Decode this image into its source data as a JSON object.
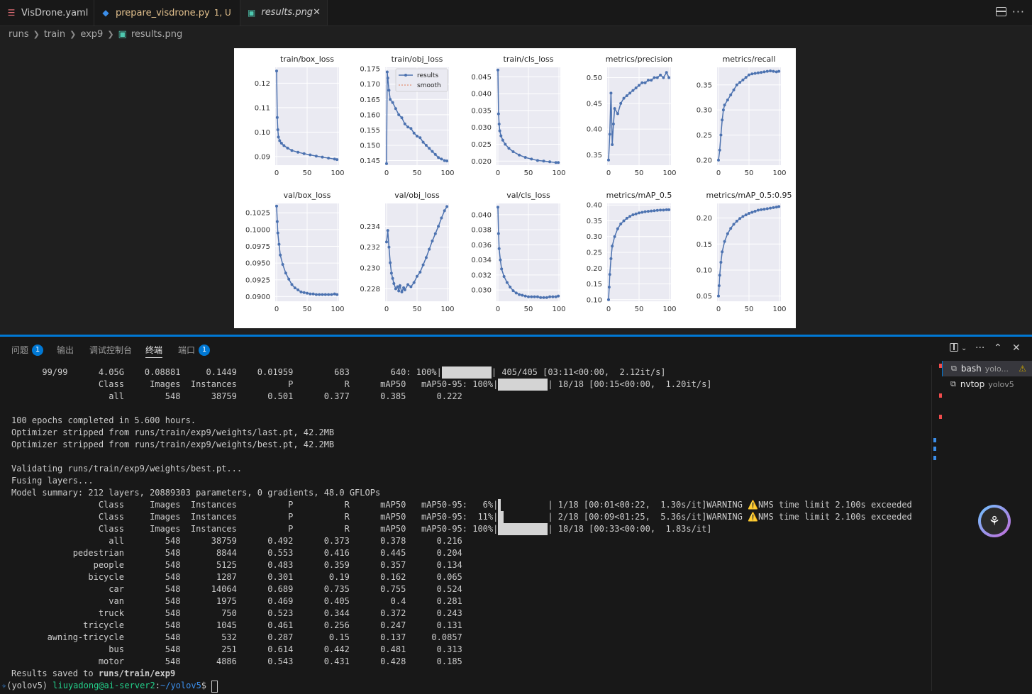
{
  "tabs": [
    {
      "label": "VisDrone.yaml",
      "icon": "yaml-icon",
      "color": "#e06c75"
    },
    {
      "label": "prepare_visdrone.py",
      "suffix": "1, U",
      "icon": "python-icon",
      "color": "#e2c08d"
    },
    {
      "label": "results.png",
      "icon": "image-icon",
      "color": "#cccccc"
    }
  ],
  "breadcrumb": [
    "runs",
    "train",
    "exp9",
    "results.png"
  ],
  "charts": {
    "legend": [
      "results",
      "smooth"
    ],
    "series_color": "#4c72b0",
    "smooth_color": "#e07b54"
  },
  "chart_data": [
    {
      "type": "line",
      "title": "train/box_loss",
      "x_ticks": [
        "0",
        "50",
        "100"
      ],
      "y_ticks": [
        "0.12",
        "0.11",
        "0.10",
        "0.09"
      ],
      "ylim": [
        0.0865,
        0.1265
      ],
      "x": [
        0,
        1,
        2,
        3,
        5,
        8,
        12,
        18,
        25,
        35,
        45,
        55,
        65,
        75,
        85,
        95,
        99
      ],
      "y": [
        0.125,
        0.106,
        0.101,
        0.098,
        0.0965,
        0.0955,
        0.0945,
        0.0935,
        0.0925,
        0.0918,
        0.0912,
        0.0907,
        0.0902,
        0.0898,
        0.0894,
        0.089,
        0.0888
      ]
    },
    {
      "type": "line",
      "title": "train/obj_loss",
      "x_ticks": [
        "0",
        "50",
        "100"
      ],
      "y_ticks": [
        "0.175",
        "0.170",
        "0.165",
        "0.160",
        "0.155",
        "0.150",
        "0.145"
      ],
      "ylim": [
        0.1435,
        0.1755
      ],
      "x": [
        0,
        1,
        2,
        4,
        6,
        10,
        15,
        20,
        25,
        30,
        35,
        40,
        45,
        50,
        55,
        60,
        65,
        70,
        75,
        80,
        85,
        90,
        95,
        99
      ],
      "y": [
        0.144,
        0.174,
        0.172,
        0.168,
        0.165,
        0.164,
        0.162,
        0.16,
        0.159,
        0.157,
        0.156,
        0.1555,
        0.154,
        0.153,
        0.1525,
        0.151,
        0.15,
        0.149,
        0.148,
        0.147,
        0.146,
        0.1455,
        0.145,
        0.1449
      ]
    },
    {
      "type": "line",
      "title": "train/cls_loss",
      "x_ticks": [
        "0",
        "50",
        "100"
      ],
      "y_ticks": [
        "0.045",
        "0.040",
        "0.035",
        "0.030",
        "0.025",
        "0.020"
      ],
      "ylim": [
        0.0188,
        0.0478
      ],
      "x": [
        0,
        1,
        2,
        3,
        5,
        8,
        12,
        18,
        25,
        35,
        45,
        55,
        65,
        75,
        85,
        95,
        99
      ],
      "y": [
        0.047,
        0.034,
        0.031,
        0.029,
        0.0275,
        0.0262,
        0.025,
        0.0238,
        0.0228,
        0.0218,
        0.0211,
        0.0206,
        0.0202,
        0.02,
        0.0198,
        0.0196,
        0.0196
      ]
    },
    {
      "type": "line",
      "title": "metrics/precision",
      "x_ticks": [
        "0",
        "50",
        "100"
      ],
      "y_ticks": [
        "0.50",
        "0.45",
        "0.40",
        "0.35"
      ],
      "ylim": [
        0.33,
        0.52
      ],
      "x": [
        0,
        2,
        4,
        6,
        8,
        10,
        15,
        20,
        25,
        30,
        35,
        40,
        45,
        50,
        55,
        60,
        65,
        70,
        75,
        80,
        85,
        90,
        95,
        99
      ],
      "y": [
        0.34,
        0.39,
        0.47,
        0.37,
        0.41,
        0.44,
        0.43,
        0.45,
        0.46,
        0.465,
        0.47,
        0.475,
        0.48,
        0.485,
        0.49,
        0.49,
        0.495,
        0.495,
        0.5,
        0.5,
        0.505,
        0.5,
        0.51,
        0.5
      ]
    },
    {
      "type": "line",
      "title": "metrics/recall",
      "x_ticks": [
        "0",
        "50",
        "100"
      ],
      "y_ticks": [
        "0.35",
        "0.30",
        "0.25",
        "0.20"
      ],
      "ylim": [
        0.19,
        0.385
      ],
      "x": [
        0,
        2,
        4,
        6,
        8,
        10,
        15,
        20,
        25,
        30,
        35,
        40,
        45,
        50,
        55,
        60,
        65,
        70,
        75,
        80,
        85,
        90,
        95,
        99
      ],
      "y": [
        0.2,
        0.22,
        0.25,
        0.28,
        0.3,
        0.31,
        0.32,
        0.33,
        0.34,
        0.35,
        0.355,
        0.36,
        0.365,
        0.37,
        0.372,
        0.373,
        0.374,
        0.375,
        0.376,
        0.377,
        0.378,
        0.377,
        0.376,
        0.377
      ]
    },
    {
      "type": "line",
      "title": "val/box_loss",
      "x_ticks": [
        "0",
        "50",
        "100"
      ],
      "y_ticks": [
        "0.1025",
        "0.1000",
        "0.0975",
        "0.0950",
        "0.0925",
        "0.0900"
      ],
      "ylim": [
        0.0893,
        0.1039
      ],
      "x": [
        0,
        1,
        2,
        4,
        6,
        10,
        15,
        20,
        25,
        30,
        35,
        40,
        45,
        50,
        55,
        60,
        65,
        70,
        75,
        80,
        85,
        90,
        95,
        99
      ],
      "y": [
        0.1035,
        0.1012,
        0.0995,
        0.0978,
        0.0962,
        0.0948,
        0.0935,
        0.0926,
        0.0918,
        0.0913,
        0.091,
        0.0907,
        0.0906,
        0.0905,
        0.0904,
        0.0904,
        0.0903,
        0.0903,
        0.0903,
        0.0903,
        0.0903,
        0.0903,
        0.0904,
        0.0903
      ]
    },
    {
      "type": "line",
      "title": "val/obj_loss",
      "x_ticks": [
        "0",
        "50",
        "100"
      ],
      "y_ticks": [
        "0.234",
        "0.232",
        "0.230",
        "0.228"
      ],
      "ylim": [
        0.2268,
        0.2362
      ],
      "x": [
        0,
        2,
        4,
        6,
        8,
        10,
        12,
        15,
        18,
        20,
        22,
        25,
        28,
        30,
        35,
        40,
        45,
        50,
        55,
        60,
        65,
        70,
        75,
        80,
        85,
        90,
        95,
        99
      ],
      "y": [
        0.2325,
        0.2336,
        0.232,
        0.2305,
        0.2295,
        0.229,
        0.2285,
        0.228,
        0.2282,
        0.2278,
        0.2283,
        0.2277,
        0.2281,
        0.2279,
        0.2284,
        0.2282,
        0.2286,
        0.2292,
        0.2296,
        0.2303,
        0.231,
        0.2318,
        0.2326,
        0.2333,
        0.234,
        0.2348,
        0.2355,
        0.2359
      ]
    },
    {
      "type": "line",
      "title": "val/cls_loss",
      "x_ticks": [
        "0",
        "50",
        "100"
      ],
      "y_ticks": [
        "0.040",
        "0.038",
        "0.036",
        "0.034",
        "0.032",
        "0.030"
      ],
      "ylim": [
        0.0285,
        0.0415
      ],
      "x": [
        0,
        1,
        2,
        4,
        6,
        10,
        15,
        20,
        25,
        30,
        35,
        40,
        45,
        50,
        55,
        60,
        65,
        70,
        75,
        80,
        85,
        90,
        95,
        99
      ],
      "y": [
        0.041,
        0.0375,
        0.0355,
        0.034,
        0.0328,
        0.0318,
        0.031,
        0.0304,
        0.0299,
        0.0296,
        0.0294,
        0.0293,
        0.0292,
        0.0291,
        0.0291,
        0.0291,
        0.0291,
        0.029,
        0.029,
        0.029,
        0.0291,
        0.0291,
        0.0291,
        0.0292
      ]
    },
    {
      "type": "line",
      "title": "metrics/mAP_0.5",
      "x_ticks": [
        "0",
        "50",
        "100"
      ],
      "y_ticks": [
        "0.40",
        "0.35",
        "0.30",
        "0.25",
        "0.20",
        "0.15",
        "0.10"
      ],
      "ylim": [
        0.095,
        0.405
      ],
      "x": [
        0,
        1,
        2,
        4,
        6,
        10,
        15,
        20,
        25,
        30,
        35,
        40,
        45,
        50,
        55,
        60,
        65,
        70,
        75,
        80,
        85,
        90,
        95,
        99
      ],
      "y": [
        0.1,
        0.14,
        0.18,
        0.23,
        0.27,
        0.3,
        0.325,
        0.34,
        0.35,
        0.358,
        0.364,
        0.369,
        0.372,
        0.375,
        0.377,
        0.379,
        0.38,
        0.381,
        0.382,
        0.383,
        0.384,
        0.384,
        0.385,
        0.385
      ]
    },
    {
      "type": "line",
      "title": "metrics/mAP_0.5:0.95",
      "x_ticks": [
        "0",
        "50",
        "100"
      ],
      "y_ticks": [
        "0.20",
        "0.15",
        "0.10",
        "0.05"
      ],
      "ylim": [
        0.04,
        0.228
      ],
      "x": [
        0,
        1,
        2,
        4,
        6,
        10,
        15,
        20,
        25,
        30,
        35,
        40,
        45,
        50,
        55,
        60,
        65,
        70,
        75,
        80,
        85,
        90,
        95,
        99
      ],
      "y": [
        0.05,
        0.07,
        0.09,
        0.115,
        0.135,
        0.155,
        0.17,
        0.18,
        0.188,
        0.194,
        0.199,
        0.203,
        0.206,
        0.209,
        0.211,
        0.213,
        0.215,
        0.216,
        0.217,
        0.218,
        0.219,
        0.22,
        0.221,
        0.222
      ]
    }
  ],
  "panel": {
    "tabs": [
      {
        "label": "问题",
        "badge": "1"
      },
      {
        "label": "输出"
      },
      {
        "label": "调试控制台"
      },
      {
        "label": "终端"
      },
      {
        "label": "端口",
        "badge": "1"
      }
    ],
    "terminals": [
      {
        "name": "bash",
        "sub": "yolo...",
        "warn": "⚠"
      },
      {
        "name": "nvtop",
        "sub": "yolov5"
      }
    ]
  },
  "terminal": {
    "lines": [
      "      99/99      4.05G    0.08881     0.1449    0.01959        683        640: 100%|",
      "                 Class     Images  Instances          P          R      mAP50   mAP50-95: 100%|",
      "                   all        548      38759      0.501      0.377      0.385      0.222",
      "",
      "100 epochs completed in 5.600 hours.",
      "Optimizer stripped from runs/train/exp9/weights/last.pt, 42.2MB",
      "Optimizer stripped from runs/train/exp9/weights/best.pt, 42.2MB",
      "",
      "Validating runs/train/exp9/weights/best.pt...",
      "Fusing layers...",
      "Model summary: 212 layers, 20889303 parameters, 0 gradients, 48.0 GFLOPs",
      "                 Class     Images  Instances          P          R      mAP50   mAP50-95:   6%|",
      "                 Class     Images  Instances          P          R      mAP50   mAP50-95:  11%|",
      "                 Class     Images  Instances          P          R      mAP50   mAP50-95: 100%|",
      "                   all        548      38759      0.492      0.373      0.378      0.216",
      "            pedestrian        548       8844      0.553      0.416      0.445      0.204",
      "                people        548       5125      0.483      0.359      0.357      0.134",
      "               bicycle        548       1287      0.301       0.19      0.162      0.065",
      "                   car        548      14064      0.689      0.735      0.755      0.524",
      "                   van        548       1975      0.469      0.405        0.4      0.281",
      "                 truck        548        750      0.523      0.344      0.372      0.243",
      "              tricycle        548       1045      0.461      0.256      0.247      0.131",
      "       awning-tricycle        548        532      0.287       0.15      0.137     0.0857",
      "                   bus        548        251      0.614      0.442      0.481      0.313",
      "                 motor        548       4886      0.543      0.431      0.428      0.185",
      "Results saved to ",
      "(yolov5) "
    ],
    "bars": [
      {
        "line": 0,
        "fill": 1.0,
        "suffix": "| 405/405 [03:11<00:00,  2.12it/s]"
      },
      {
        "line": 1,
        "fill": 1.0,
        "suffix": "| 18/18 [00:15<00:00,  1.20it/s]"
      },
      {
        "line": 11,
        "fill": 0.06,
        "suffix": "| 1/18 [00:01<00:22,  1.30s/it]WARNING ⚠️NMS time limit 2.100s exceeded"
      },
      {
        "line": 12,
        "fill": 0.11,
        "suffix": "| 2/18 [00:09<01:25,  5.36s/it]WARNING ⚠️NMS time limit 2.100s exceeded"
      },
      {
        "line": 13,
        "fill": 1.0,
        "suffix": "| 18/18 [00:33<00:00,  1.83s/it]"
      }
    ],
    "results_path": "runs/train/exp9",
    "prompt_user": "liuyadong@ai-server2",
    "prompt_path": "~/yolov5",
    "prompt_end": "$ "
  }
}
